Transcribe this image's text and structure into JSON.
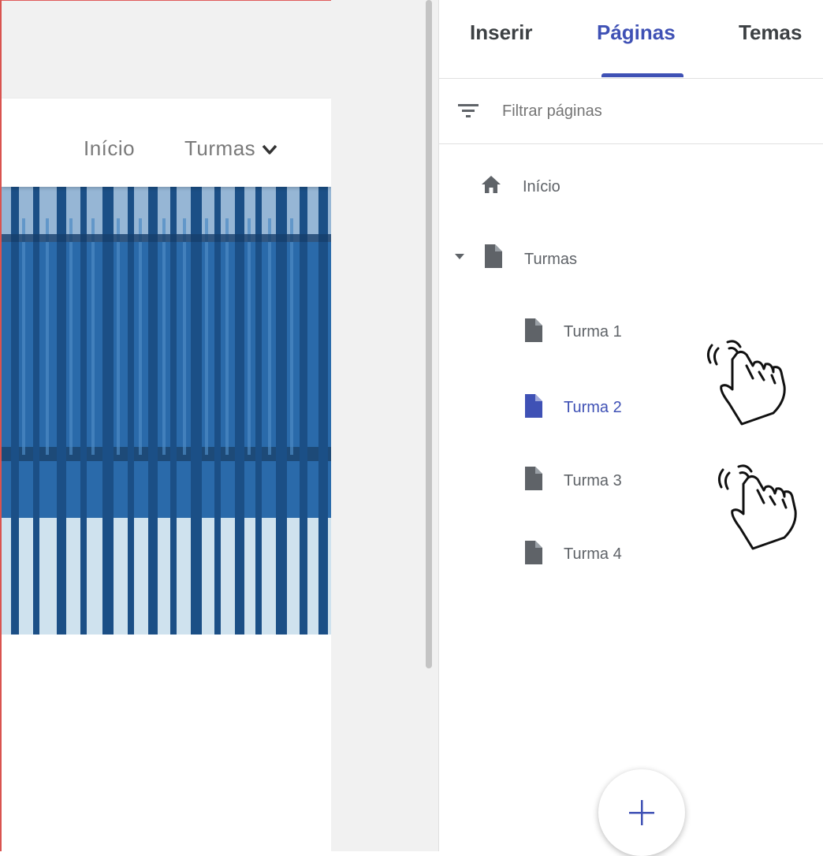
{
  "preview": {
    "nav": {
      "home_label": "Início",
      "classes_label": "Turmas",
      "chevron_icon": "chevron-down-icon"
    }
  },
  "panel": {
    "tabs": [
      {
        "label": "Inserir",
        "active": false
      },
      {
        "label": "Páginas",
        "active": true
      },
      {
        "label": "Temas",
        "active": false
      }
    ],
    "filter": {
      "placeholder": "Filtrar páginas",
      "icon": "filter-icon"
    },
    "pages": [
      {
        "label": "Início",
        "icon": "home-icon"
      },
      {
        "label": "Turmas",
        "icon": "page-icon",
        "expanded": true
      },
      {
        "label": "Turma 1",
        "icon": "page-icon"
      },
      {
        "label": "Turma 2",
        "icon": "page-icon",
        "selected": true
      },
      {
        "label": "Turma 3",
        "icon": "page-icon"
      },
      {
        "label": "Turma 4",
        "icon": "page-icon"
      }
    ],
    "add_button": {
      "icon": "plus-icon"
    }
  },
  "colors": {
    "accent": "#3f51b5",
    "icon_grey": "#5f6368",
    "frame_red": "#d9534f"
  }
}
